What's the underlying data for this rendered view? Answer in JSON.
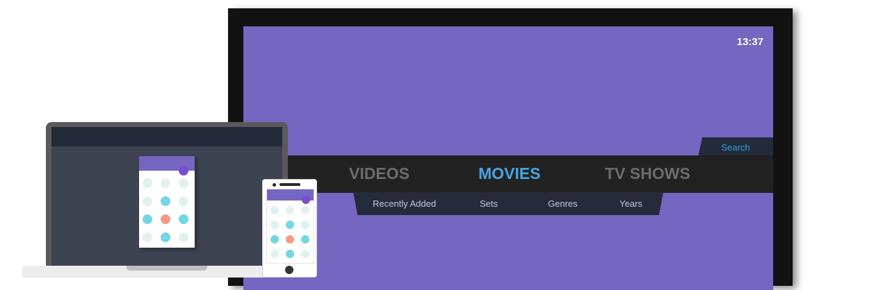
{
  "tv": {
    "clock": "13:37",
    "search_label": "Search",
    "main_nav": [
      {
        "label": "VIDEOS",
        "active": false
      },
      {
        "label": "MOVIES",
        "active": true
      },
      {
        "label": "TV SHOWS",
        "active": false
      }
    ],
    "sub_nav": [
      "Recently Added",
      "Sets",
      "Genres",
      "Years"
    ]
  },
  "icons": [
    "search-icon"
  ],
  "colors": {
    "screen_purple": "#7566c1",
    "nav_bar": "#222222",
    "active_nav": "#47a4e2",
    "inactive_nav": "#6c6c6c",
    "search_text": "#2aa4e2",
    "subnav_bg": "#252b3b",
    "dot_mint": "#e1f1ef",
    "dot_cyan": "#73d6e4",
    "dot_coral": "#f59c84",
    "fab_purple": "#7b4ed0"
  },
  "app_grid": {
    "rows": [
      [
        "mint",
        "mint",
        "mint"
      ],
      [
        "mint",
        "cyan",
        "mint"
      ],
      [
        "cyan",
        "coral",
        "cyan"
      ],
      [
        "mint",
        "cyan",
        "mint"
      ]
    ]
  }
}
